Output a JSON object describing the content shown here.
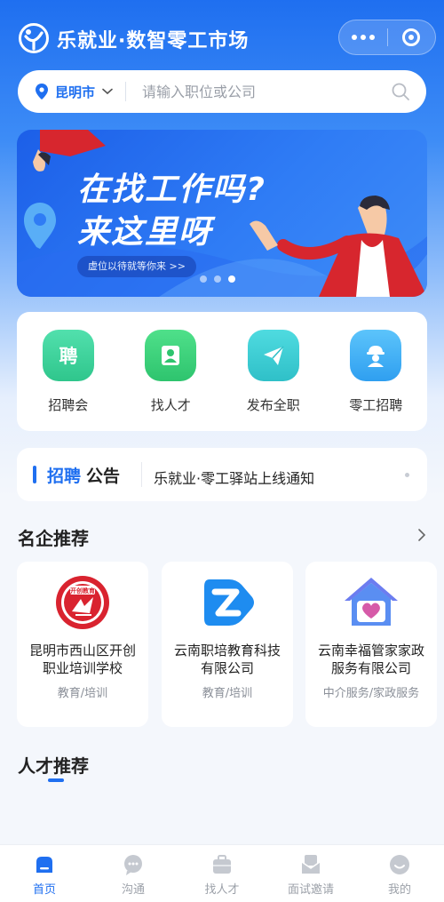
{
  "header": {
    "app_title": "乐就业·数智零工市场"
  },
  "search": {
    "city": "昆明市",
    "placeholder": "请输入职位或公司"
  },
  "banner": {
    "line1": "在找工作吗?",
    "line2": "来这里呀",
    "subtitle": "虚位以待就等你来 >>",
    "slide_count": 3,
    "active_slide": 3
  },
  "quick_actions": [
    {
      "label": "招聘会",
      "icon": "hiring-fair-icon",
      "color": "#3ccf9a"
    },
    {
      "label": "找人才",
      "icon": "talent-icon",
      "color": "#36c97a"
    },
    {
      "label": "发布全职",
      "icon": "paper-plane-icon",
      "color": "#39c6cf"
    },
    {
      "label": "零工招聘",
      "icon": "worker-icon",
      "color": "#3aa9f1"
    }
  ],
  "notice": {
    "title_part1": "招聘",
    "title_part2": "公告",
    "text": "乐就业·零工驿站上线通知"
  },
  "featured": {
    "title": "名企推荐",
    "companies": [
      {
        "name": "昆明市西山区开创职业培训学校",
        "category": "教育/培训",
        "logo": "kaichuang-education-logo",
        "logo_text": "开创教育"
      },
      {
        "name": "云南职培教育科技有限公司",
        "category": "教育/培训",
        "logo": "z-play-logo"
      },
      {
        "name": "云南幸福管家家政服务有限公司",
        "category": "中介服务/家政服务",
        "logo": "heart-house-logo"
      }
    ]
  },
  "talent": {
    "title": "人才推荐"
  },
  "tabbar": [
    {
      "label": "首页",
      "icon": "home-icon",
      "active": true
    },
    {
      "label": "沟通",
      "icon": "chat-icon",
      "active": false
    },
    {
      "label": "找人才",
      "icon": "briefcase-icon",
      "active": false
    },
    {
      "label": "面试邀请",
      "icon": "mail-icon",
      "active": false
    },
    {
      "label": "我的",
      "icon": "profile-icon",
      "active": false
    }
  ],
  "colors": {
    "primary": "#1f6ff0",
    "muted_text": "#8a8f98"
  }
}
